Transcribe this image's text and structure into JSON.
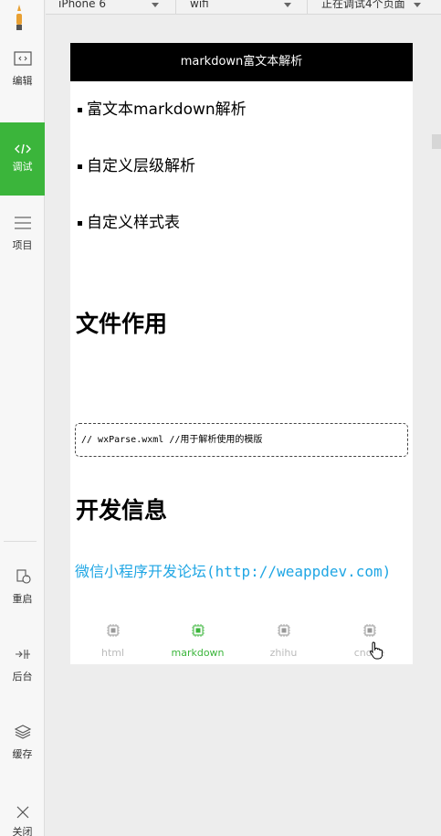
{
  "topbar": {
    "device": "iPhone 6",
    "network": "wifi",
    "debug_status": "正在调试4个页面"
  },
  "sidebar": {
    "items": [
      {
        "label": "编辑",
        "icon": "editor-icon"
      },
      {
        "label": "调试",
        "icon": "code-icon",
        "active": true
      },
      {
        "label": "项目",
        "icon": "list-icon"
      },
      {
        "label": "重启",
        "icon": "restart-icon"
      },
      {
        "label": "后台",
        "icon": "background-icon"
      },
      {
        "label": "缓存",
        "icon": "cache-icon"
      },
      {
        "label": "关闭",
        "icon": "close-icon"
      }
    ]
  },
  "phone": {
    "nav_title": "markdown富文本解析",
    "list_items": [
      "富文本markdown解析",
      "自定义层级解析",
      "自定义样式表"
    ],
    "heading1": "文件作用",
    "code_line": "// wxParse.wxml //用于解析使用的模版",
    "heading2": "开发信息",
    "link_text": "微信小程序开发论坛(http://weappdev.com)",
    "colors": {
      "link": "#1fa6e4",
      "accent": "#3bb53b",
      "navbar": "#000000"
    }
  },
  "tabbar": {
    "tabs": [
      {
        "label": "html",
        "active": false
      },
      {
        "label": "markdown",
        "active": true
      },
      {
        "label": "zhihu",
        "active": false
      },
      {
        "label": "cnode",
        "active": false
      }
    ]
  }
}
